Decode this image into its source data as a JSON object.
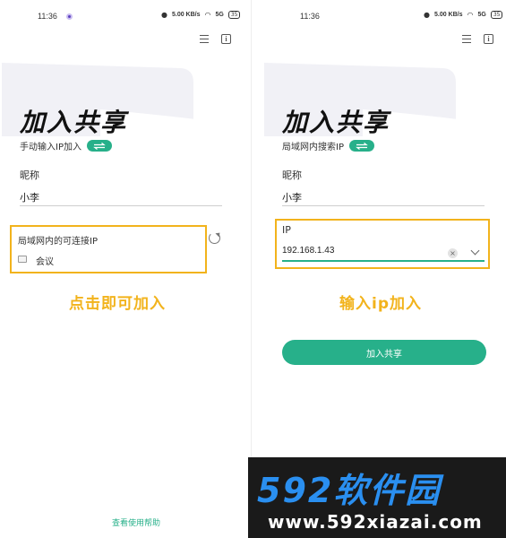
{
  "colors": {
    "accent": "#27b08a",
    "highlight": "#f2b31c",
    "watermark_blue": "#2a8ff0"
  },
  "left": {
    "status": {
      "time": "11:36",
      "net": "5.00 KB/s",
      "signal": "5G",
      "battery": "35"
    },
    "title": "加入共享",
    "mode_label": "手动输入IP加入",
    "nickname_label": "昵称",
    "nickname_value": "小李",
    "lan_title": "局域网内的可连接IP",
    "room_name": "会议",
    "caption": "点击即可加入",
    "help_link": "查看使用帮助"
  },
  "right": {
    "status": {
      "time": "11:36",
      "net": "5.00 KB/s",
      "signal": "5G",
      "battery": "35"
    },
    "title": "加入共享",
    "mode_label": "局域网内搜索IP",
    "nickname_label": "昵称",
    "nickname_value": "小李",
    "ip_label": "IP",
    "ip_value": "192.168.1.43",
    "caption": "输入ip加入",
    "join_button": "加入共享"
  },
  "watermark": {
    "brand": "592软件园",
    "url": "www.592xiazai.com"
  },
  "icons": [
    "menu-icon",
    "info-icon",
    "swap-icon",
    "refresh-icon",
    "room-icon",
    "clear-icon",
    "chevron-down-icon"
  ]
}
